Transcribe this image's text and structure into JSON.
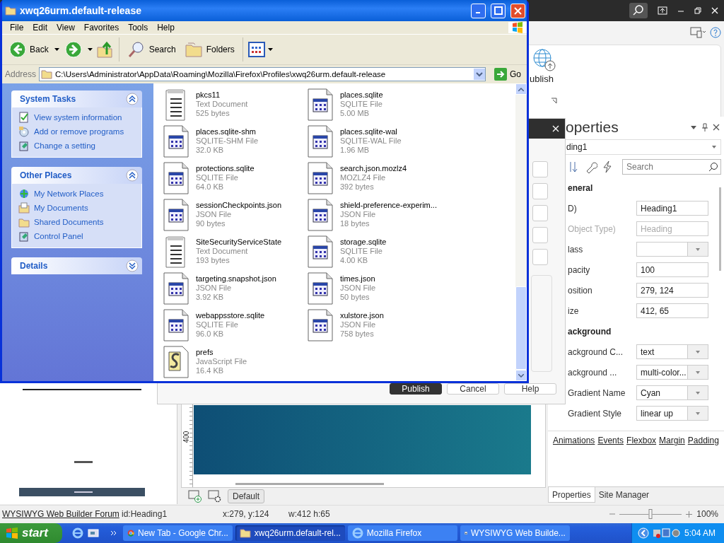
{
  "explorer": {
    "title": "xwq26urm.default-release",
    "menu": [
      "File",
      "Edit",
      "View",
      "Favorites",
      "Tools",
      "Help"
    ],
    "toolbar": {
      "back": "Back",
      "search": "Search",
      "folders": "Folders"
    },
    "address": {
      "label": "Address",
      "value": "C:\\Users\\Administrator\\AppData\\Roaming\\Mozilla\\Firefox\\Profiles\\xwq26urm.default-release",
      "go": "Go"
    },
    "panels": [
      {
        "title": "System Tasks",
        "expanded": true,
        "items": [
          {
            "label": "View system information",
            "kind": "info"
          },
          {
            "label": "Add or remove programs",
            "kind": "programs"
          },
          {
            "label": "Change a setting",
            "kind": "setting"
          }
        ]
      },
      {
        "title": "Other Places",
        "expanded": true,
        "items": [
          {
            "label": "My Network Places",
            "kind": "network"
          },
          {
            "label": "My Documents",
            "kind": "documents"
          },
          {
            "label": "Shared Documents",
            "kind": "folder"
          },
          {
            "label": "Control Panel",
            "kind": "setting"
          }
        ]
      },
      {
        "title": "Details",
        "expanded": false
      }
    ],
    "files": [
      {
        "name": "pkcs11",
        "type": "Text Document",
        "size": "525 bytes",
        "kind": "text"
      },
      {
        "name": "places.sqlite",
        "type": "SQLITE File",
        "size": "5.00 MB",
        "kind": "app"
      },
      {
        "name": "places.sqlite-shm",
        "type": "SQLITE-SHM File",
        "size": "32.0 KB",
        "kind": "app"
      },
      {
        "name": "places.sqlite-wal",
        "type": "SQLITE-WAL File",
        "size": "1.96 MB",
        "kind": "app"
      },
      {
        "name": "protections.sqlite",
        "type": "SQLITE File",
        "size": "64.0 KB",
        "kind": "app"
      },
      {
        "name": "search.json.mozlz4",
        "type": "MOZLZ4 File",
        "size": "392 bytes",
        "kind": "app"
      },
      {
        "name": "sessionCheckpoints.json",
        "type": "JSON File",
        "size": "90 bytes",
        "kind": "app"
      },
      {
        "name": "shield-preference-experim...",
        "type": "JSON File",
        "size": "18 bytes",
        "kind": "app"
      },
      {
        "name": "SiteSecurityServiceState",
        "type": "Text Document",
        "size": "193 bytes",
        "kind": "text"
      },
      {
        "name": "storage.sqlite",
        "type": "SQLITE File",
        "size": "4.00 KB",
        "kind": "app"
      },
      {
        "name": "targeting.snapshot.json",
        "type": "JSON File",
        "size": "3.92 KB",
        "kind": "app"
      },
      {
        "name": "times.json",
        "type": "JSON File",
        "size": "50 bytes",
        "kind": "app"
      },
      {
        "name": "webappsstore.sqlite",
        "type": "SQLITE File",
        "size": "96.0 KB",
        "kind": "app"
      },
      {
        "name": "xulstore.json",
        "type": "JSON File",
        "size": "758 bytes",
        "kind": "app"
      },
      {
        "name": "prefs",
        "type": "JavaScript File",
        "size": "16.4 KB",
        "kind": "script"
      }
    ]
  },
  "builder": {
    "ribbon": {
      "publish": "ublish"
    },
    "dialog": {
      "buttons": [
        {
          "label": "Publish",
          "kind": "primary"
        },
        {
          "label": "Cancel",
          "kind": "normal"
        },
        {
          "label": "Help",
          "kind": "normal"
        }
      ]
    },
    "properties": {
      "title": "operties",
      "object": "ding1",
      "search": {
        "placeholder": "Search"
      },
      "rows": [
        {
          "kind": "category",
          "label": "eneral"
        },
        {
          "kind": "text",
          "label": "D)",
          "value": "Heading1",
          "disabled": false
        },
        {
          "kind": "text",
          "label": "Object Type)",
          "value": "Heading",
          "disabled": true
        },
        {
          "kind": "dropdown",
          "label": "lass"
        },
        {
          "kind": "text",
          "label": "pacity",
          "value": "100",
          "disabled": false
        },
        {
          "kind": "text",
          "label": "osition",
          "value": "279, 124",
          "disabled": false
        },
        {
          "kind": "text",
          "label": "ize",
          "value": "412, 65",
          "disabled": false
        },
        {
          "kind": "category",
          "label": "ackground"
        },
        {
          "kind": "dropdown",
          "label": "ackground C...",
          "value": "text"
        },
        {
          "kind": "dropdown",
          "label": "ackground ...",
          "value": "multi-color..."
        },
        {
          "kind": "dropdown",
          "label": "Gradient Name",
          "value": "Cyan"
        },
        {
          "kind": "dropdown",
          "label": "Gradient Style",
          "value": "linear up"
        }
      ],
      "links": [
        "Animations",
        "Events",
        "Flexbox",
        "Margin",
        "Padding"
      ],
      "tabs": [
        {
          "label": "Properties",
          "selected": true
        },
        {
          "label": "Site Manager",
          "selected": false
        }
      ]
    },
    "canvas": {
      "ruler_label": "400",
      "page_button": "Default"
    },
    "status_bar": {
      "link": "WYSIWYG Web Builder Forum",
      "id": "id:Heading1",
      "position": "x:279, y:124",
      "size": "w:412 h:65",
      "zoom": {
        "level": 0.5,
        "reading": "100%"
      }
    }
  },
  "taskbar": {
    "start": "start",
    "tasks": [
      {
        "label": "New Tab - Google Chr...",
        "kind": "chrome",
        "selected": false
      },
      {
        "label": "xwq26urm.default-rel...",
        "kind": "folder",
        "selected": true
      },
      {
        "label": "Mozilla Firefox",
        "kind": "ie",
        "selected": false
      },
      {
        "label": "WYSIWYG Web Builde...",
        "kind": "builder",
        "selected": false
      }
    ],
    "clock": "5:04 AM"
  }
}
